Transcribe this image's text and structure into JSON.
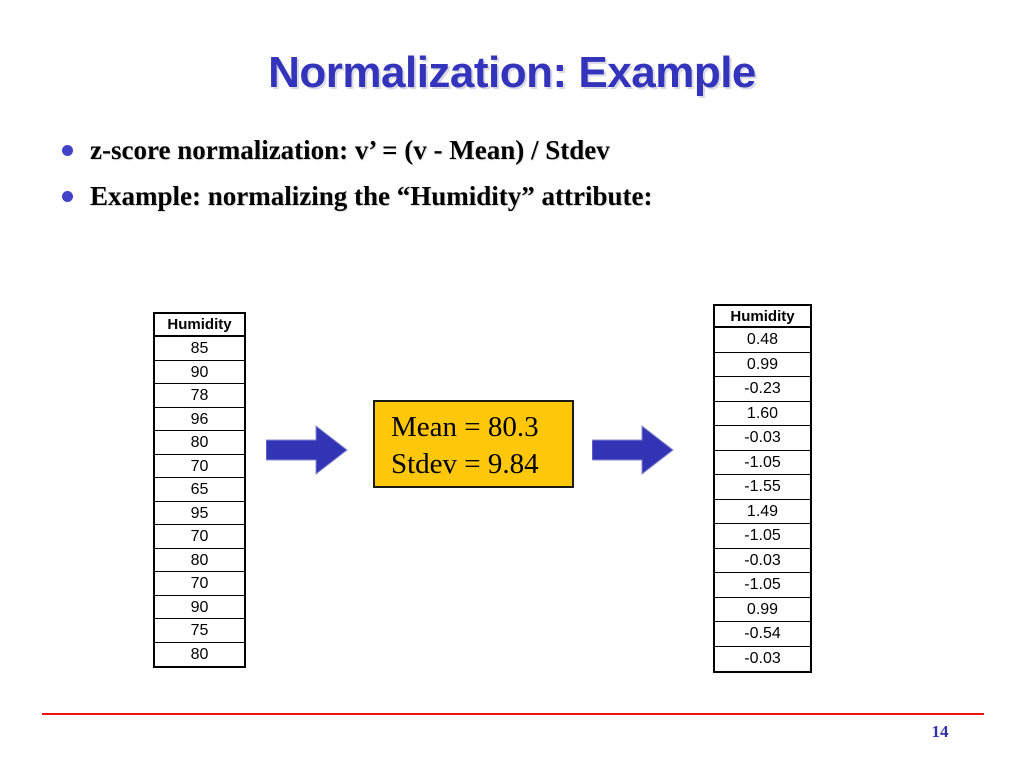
{
  "slide": {
    "title": "Normalization: Example",
    "page_number": "14",
    "title_color": "#3333bb",
    "accent_rule_color": "#ee1111",
    "bullet_color": "#4242c8",
    "box_color": "#FFC709",
    "arrow_color": "#3333b5"
  },
  "bullets": [
    {
      "text": "z-score normalization:  v’ = (v - Mean) / Stdev"
    },
    {
      "text": "Example: normalizing the “Humidity” attribute:"
    }
  ],
  "input_table": {
    "name": "input-humidity-table",
    "header": "Humidity",
    "values": [
      "85",
      "90",
      "78",
      "96",
      "80",
      "70",
      "65",
      "95",
      "70",
      "80",
      "70",
      "90",
      "75",
      "80"
    ]
  },
  "output_table": {
    "name": "normalized-humidity-table",
    "header": "Humidity",
    "values": [
      "0.48",
      "0.99",
      "-0.23",
      "1.60",
      "-0.03",
      "-1.05",
      "-1.55",
      "1.49",
      "-1.05",
      "-0.03",
      "-1.05",
      "0.99",
      "-0.54",
      "-0.03"
    ]
  },
  "stats_box": {
    "mean_line": "Mean = 80.3",
    "stdev_line": "Stdev = 9.84",
    "mean_value": "80.3",
    "stdev_value": "9.84"
  },
  "arrows": [
    {
      "name": "arrow-right-icon-1",
      "direction": "right"
    },
    {
      "name": "arrow-right-icon-2",
      "direction": "right"
    }
  ],
  "chart_data": {
    "type": "table",
    "title": "Normalization: Example",
    "description": "z-score normalization of the Humidity attribute",
    "formula": "v' = (v - Mean) / Stdev",
    "mean": 80.3,
    "stdev": 9.84,
    "columns": [
      "Humidity (raw)",
      "Humidity (z-score)"
    ],
    "rows": [
      [
        "85",
        "0.48"
      ],
      [
        "90",
        "0.99"
      ],
      [
        "78",
        "-0.23"
      ],
      [
        "96",
        "1.60"
      ],
      [
        "80",
        "-0.03"
      ],
      [
        "70",
        "-1.05"
      ],
      [
        "65",
        "-1.55"
      ],
      [
        "95",
        "1.49"
      ],
      [
        "70",
        "-1.05"
      ],
      [
        "80",
        "-0.03"
      ],
      [
        "70",
        "-1.05"
      ],
      [
        "90",
        "0.99"
      ],
      [
        "75",
        "-0.54"
      ],
      [
        "80",
        "-0.03"
      ]
    ]
  }
}
